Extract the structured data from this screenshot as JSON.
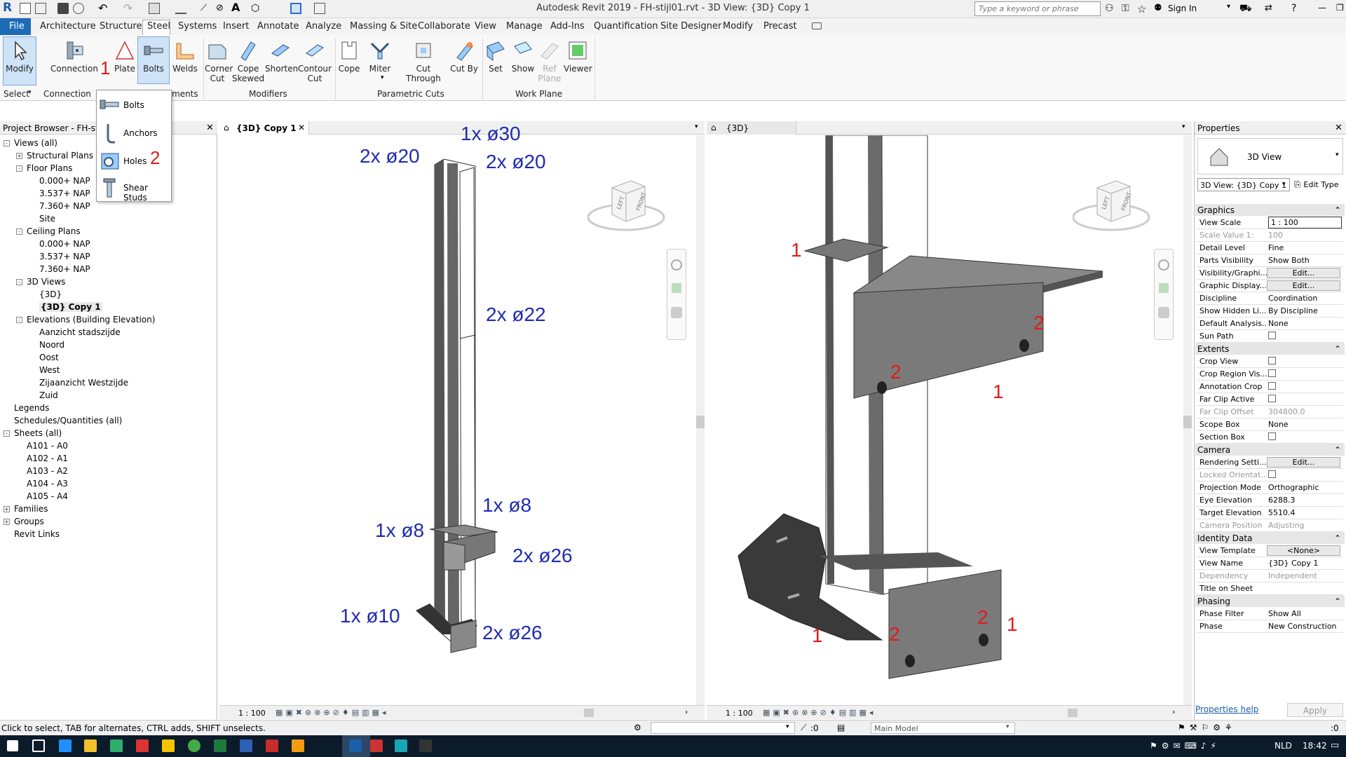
{
  "window": {
    "title": "Autodesk Revit 2019 - FH-stijl01.rvt - 3D View: {3D} Copy 1",
    "search_placeholder": "Type a keyword or phrase",
    "sign_in": "Sign In"
  },
  "menu": [
    "File",
    "Architecture",
    "Structure",
    "Steel",
    "Systems",
    "Insert",
    "Annotate",
    "Analyze",
    "Massing & Site",
    "Collaborate",
    "View",
    "Manage",
    "Add-Ins",
    "Quantification",
    "Site Designer",
    "Modify",
    "Precast"
  ],
  "ribbon": {
    "buttons": [
      "Modify",
      "Connection",
      "Plate",
      "Bolts",
      "Welds",
      "Corner Cut",
      "Cope Skewed",
      "Shorten",
      "Contour Cut",
      "Cope",
      "Miter",
      "Cut Through",
      "Cut By",
      "Set",
      "Show",
      "Ref Plane",
      "Viewer"
    ],
    "panels": [
      "Select",
      "Connection",
      "ments",
      "Modifiers",
      "Parametric Cuts",
      "Work Plane"
    ]
  },
  "bolts_dropdown": [
    "Bolts",
    "Anchors",
    "Holes",
    "Shear Studs"
  ],
  "callouts": {
    "connection_num": "1",
    "holes_num": "2"
  },
  "project_browser": {
    "title": "Project Browser - FH-stijl0",
    "items": [
      {
        "label": "Views (all)",
        "lvl": 0,
        "tog": "-"
      },
      {
        "label": "Structural Plans",
        "lvl": 1,
        "tog": "+"
      },
      {
        "label": "Floor Plans",
        "lvl": 1,
        "tog": "-"
      },
      {
        "label": "0.000+ NAP",
        "lvl": 2
      },
      {
        "label": "3.537+ NAP",
        "lvl": 2
      },
      {
        "label": "7.360+ NAP",
        "lvl": 2
      },
      {
        "label": "Site",
        "lvl": 2
      },
      {
        "label": "Ceiling Plans",
        "lvl": 1,
        "tog": "-"
      },
      {
        "label": "0.000+ NAP",
        "lvl": 2
      },
      {
        "label": "3.537+ NAP",
        "lvl": 2
      },
      {
        "label": "7.360+ NAP",
        "lvl": 2
      },
      {
        "label": "3D Views",
        "lvl": 1,
        "tog": "-"
      },
      {
        "label": "{3D}",
        "lvl": 2
      },
      {
        "label": "{3D} Copy 1",
        "lvl": 2,
        "bold": true
      },
      {
        "label": "Elevations (Building Elevation)",
        "lvl": 1,
        "tog": "-"
      },
      {
        "label": "Aanzicht stadszijde",
        "lvl": 2
      },
      {
        "label": "Noord",
        "lvl": 2
      },
      {
        "label": "Oost",
        "lvl": 2
      },
      {
        "label": "West",
        "lvl": 2
      },
      {
        "label": "Zijaanzicht Westzijde",
        "lvl": 2
      },
      {
        "label": "Zuid",
        "lvl": 2
      },
      {
        "label": "Legends",
        "lvl": 0
      },
      {
        "label": "Schedules/Quantities (all)",
        "lvl": 0
      },
      {
        "label": "Sheets (all)",
        "lvl": 0,
        "tog": "-"
      },
      {
        "label": "A101 - A0",
        "lvl": 1
      },
      {
        "label": "A102 - A1",
        "lvl": 1
      },
      {
        "label": "A103 - A2",
        "lvl": 1
      },
      {
        "label": "A104 - A3",
        "lvl": 1
      },
      {
        "label": "A105 - A4",
        "lvl": 1
      },
      {
        "label": "Families",
        "lvl": 0,
        "tog": "+"
      },
      {
        "label": "Groups",
        "lvl": 0,
        "tog": "+"
      },
      {
        "label": "Revit Links",
        "lvl": 0
      }
    ]
  },
  "view1": {
    "tab": "{3D} Copy 1",
    "scale": "1 : 100",
    "labels": [
      "1x ø30",
      "2x ø20",
      "2x ø20",
      "2x ø22",
      "1x ø8",
      "1x ø8",
      "2x ø26",
      "1x ø10",
      "2x ø26"
    ]
  },
  "view2": {
    "tab": "{3D}",
    "scale": "1 : 100",
    "labels": [
      "1",
      "2",
      "2",
      "1",
      "1",
      "2",
      "2",
      "1"
    ]
  },
  "viewcube": {
    "left": "LEFT",
    "front": "FRONT"
  },
  "properties": {
    "title": "Properties",
    "family": "3D View",
    "selector": "3D View: {3D} Copy 1",
    "edit_type": "Edit Type",
    "sections": [
      {
        "name": "Graphics",
        "rows": [
          [
            "View Scale",
            "1 : 100"
          ],
          [
            "Scale Value    1:",
            "100"
          ],
          [
            "Detail Level",
            "Fine"
          ],
          [
            "Parts Visibility",
            "Show Both"
          ],
          [
            "Visibility/Graphi...",
            "Edit..."
          ],
          [
            "Graphic Display...",
            "Edit..."
          ],
          [
            "Discipline",
            "Coordination"
          ],
          [
            "Show Hidden Li...",
            "By Discipline"
          ],
          [
            "Default Analysis...",
            "None"
          ],
          [
            "Sun Path",
            ""
          ]
        ]
      },
      {
        "name": "Extents",
        "rows": [
          [
            "Crop View",
            ""
          ],
          [
            "Crop Region Vis...",
            ""
          ],
          [
            "Annotation Crop",
            ""
          ],
          [
            "Far Clip Active",
            ""
          ],
          [
            "Far Clip Offset",
            "304800.0"
          ],
          [
            "Scope Box",
            "None"
          ],
          [
            "Section Box",
            ""
          ]
        ]
      },
      {
        "name": "Camera",
        "rows": [
          [
            "Rendering Setti...",
            "Edit..."
          ],
          [
            "Locked Orientat...",
            ""
          ],
          [
            "Projection Mode",
            "Orthographic"
          ],
          [
            "Eye Elevation",
            "6288.3"
          ],
          [
            "Target Elevation",
            "5510.4"
          ],
          [
            "Camera Position",
            "Adjusting"
          ]
        ]
      },
      {
        "name": "Identity Data",
        "rows": [
          [
            "View Template",
            "<None>"
          ],
          [
            "View Name",
            "{3D} Copy 1"
          ],
          [
            "Dependency",
            "Independent"
          ],
          [
            "Title on Sheet",
            ""
          ]
        ]
      },
      {
        "name": "Phasing",
        "rows": [
          [
            "Phase Filter",
            "Show All"
          ],
          [
            "Phase",
            "New Construction"
          ]
        ]
      }
    ],
    "help": "Properties help",
    "apply": "Apply"
  },
  "status": {
    "hint": "Click to select, TAB for alternates, CTRL adds, SHIFT unselects.",
    "model": "Main Model",
    "count": ":0"
  },
  "taskbar": {
    "lang": "NLD",
    "time": "18:42"
  }
}
